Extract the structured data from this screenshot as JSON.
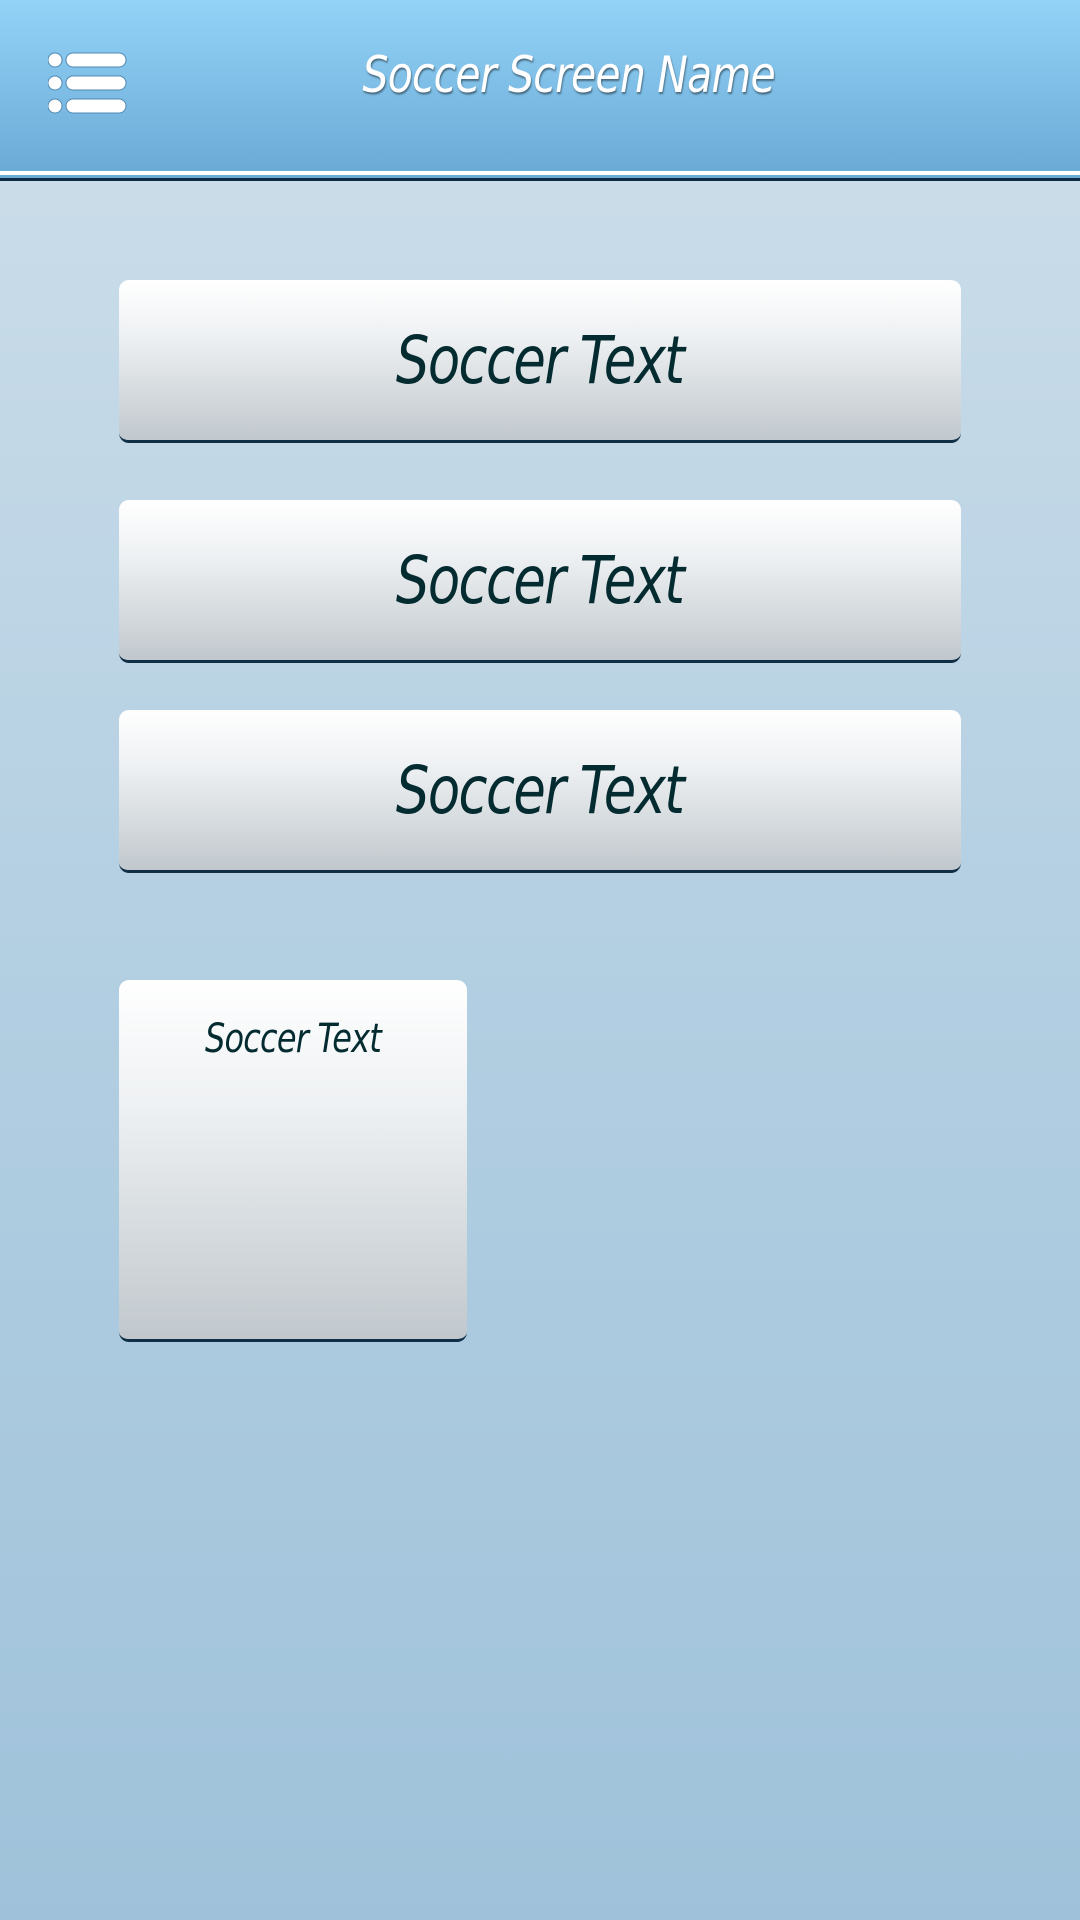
{
  "header": {
    "title": "Soccer Screen Name",
    "menu_icon": "list-menu-icon",
    "background": "#7dbde6",
    "title_color": "#ffffff"
  },
  "main": {
    "buttons": [
      {
        "label": "Soccer Text"
      },
      {
        "label": "Soccer Text"
      },
      {
        "label": "Soccer Text"
      }
    ],
    "tile": {
      "label": "Soccer Text"
    },
    "text_color": "#042b30"
  }
}
